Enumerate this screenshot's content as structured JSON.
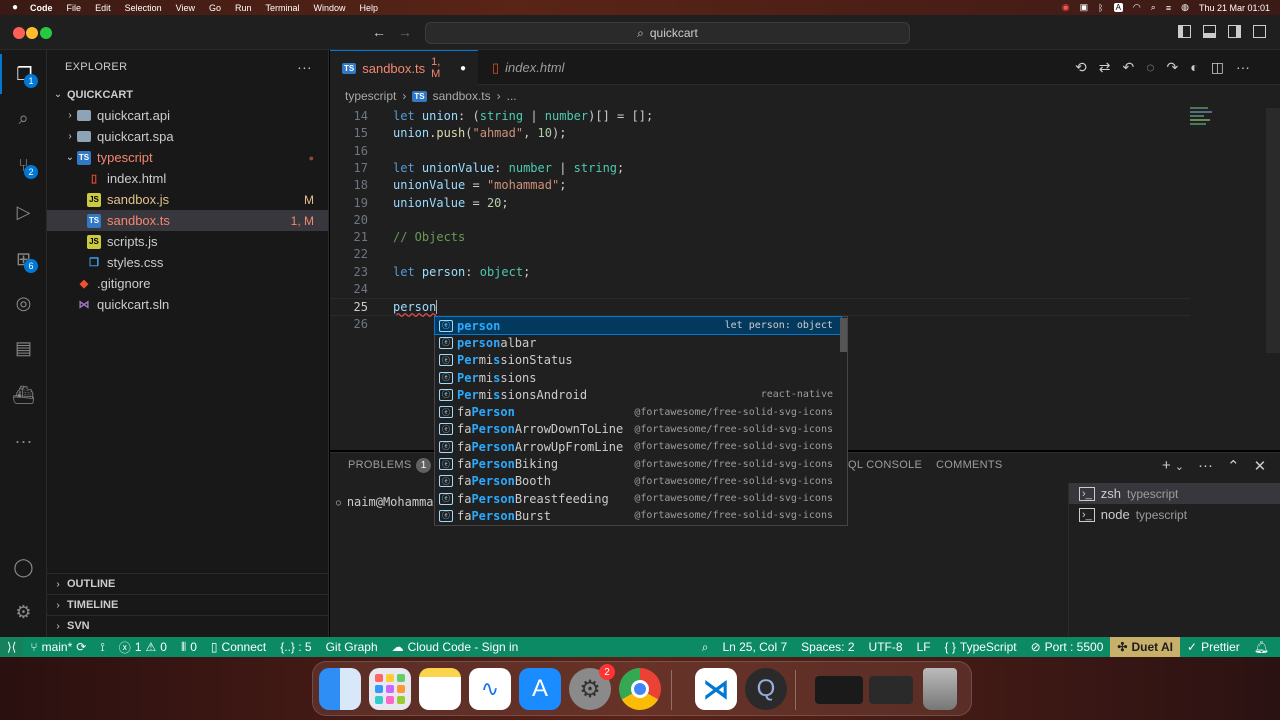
{
  "menubar": {
    "app": "Code",
    "items": [
      "File",
      "Edit",
      "Selection",
      "View",
      "Go",
      "Run",
      "Terminal",
      "Window",
      "Help"
    ],
    "datetime": "Thu 21 Mar  01:01"
  },
  "titlebar": {
    "search": "quickcart"
  },
  "activity": {
    "explorer_badge": "1",
    "scm_badge": "2",
    "extensions_badge": "6"
  },
  "sidebar": {
    "title": "EXPLORER",
    "more": "···",
    "root": "QUICKCART",
    "items": [
      {
        "label": "quickcart.api",
        "kind": "folder",
        "status": ""
      },
      {
        "label": "quickcart.spa",
        "kind": "folder",
        "status": ""
      },
      {
        "label": "typescript",
        "kind": "ts-folder",
        "status": ""
      },
      {
        "label": "index.html",
        "kind": "html",
        "status": ""
      },
      {
        "label": "sandbox.js",
        "kind": "js",
        "status": "M"
      },
      {
        "label": "sandbox.ts",
        "kind": "ts",
        "status": "1, M"
      },
      {
        "label": "scripts.js",
        "kind": "js",
        "status": ""
      },
      {
        "label": "styles.css",
        "kind": "css",
        "status": ""
      },
      {
        "label": ".gitignore",
        "kind": "git",
        "status": ""
      },
      {
        "label": "quickcart.sln",
        "kind": "sln",
        "status": ""
      }
    ],
    "outline": "OUTLINE",
    "timeline": "TIMELINE",
    "svn": "SVN"
  },
  "tabs": [
    {
      "label": "sandbox.ts",
      "badge": "1, M",
      "icon": "TS"
    },
    {
      "label": "index.html",
      "badge": "",
      "icon": "html"
    }
  ],
  "breadcrumbs": [
    "typescript",
    "sandbox.ts",
    "..."
  ],
  "code": {
    "line_numbers": [
      "14",
      "15",
      "16",
      "17",
      "18",
      "19",
      "20",
      "21",
      "22",
      "23",
      "24",
      "25",
      "26"
    ],
    "active_line": "25"
  },
  "suggest": {
    "items": [
      {
        "pre": "",
        "match": "person",
        "post": "",
        "detail": "let person: object"
      },
      {
        "pre": "",
        "match": "person",
        "post": "albar",
        "detail": ""
      },
      {
        "pre": "",
        "match": "Per",
        "post": "mi",
        "match2": "s",
        "post2": "sionStatus",
        "detail": ""
      },
      {
        "pre": "",
        "match": "Per",
        "post": "mi",
        "match2": "s",
        "post2": "sions",
        "detail": ""
      },
      {
        "pre": "",
        "match": "Per",
        "post": "mi",
        "match2": "s",
        "post2": "sionsAndroid",
        "detail": "react-native"
      },
      {
        "pre": "fa",
        "match": "Person",
        "post": "",
        "detail": "@fortawesome/free-solid-svg-icons"
      },
      {
        "pre": "fa",
        "match": "Person",
        "post": "ArrowDownToLine",
        "detail": "@fortawesome/free-solid-svg-icons"
      },
      {
        "pre": "fa",
        "match": "Person",
        "post": "ArrowUpFromLine",
        "detail": "@fortawesome/free-solid-svg-icons"
      },
      {
        "pre": "fa",
        "match": "Person",
        "post": "Biking",
        "detail": "@fortawesome/free-solid-svg-icons"
      },
      {
        "pre": "fa",
        "match": "Person",
        "post": "Booth",
        "detail": "@fortawesome/free-solid-svg-icons"
      },
      {
        "pre": "fa",
        "match": "Person",
        "post": "Breastfeeding",
        "detail": "@fortawesome/free-solid-svg-icons"
      },
      {
        "pre": "fa",
        "match": "Person",
        "post": "Burst",
        "detail": "@fortawesome/free-solid-svg-icons"
      }
    ]
  },
  "panel": {
    "problems": "PROBLEMS",
    "problems_count": "1",
    "sql_console": "QL CONSOLE",
    "comments": "COMMENTS",
    "prompt": "naim@Mohammad",
    "terminals": [
      {
        "name": "zsh",
        "cwd": "typescript"
      },
      {
        "name": "node",
        "cwd": "typescript"
      }
    ]
  },
  "statusbar": {
    "branch": "main*",
    "errors": "1",
    "warnings": "0",
    "ports_icon_count": "0",
    "connect": "Connect",
    "json": "{..} : 5",
    "git_graph": "Git Graph",
    "cloud_code": "Cloud Code - Sign in",
    "position": "Ln 25, Col 7",
    "spaces": "Spaces: 2",
    "encoding": "UTF-8",
    "eol": "LF",
    "language": "TypeScript",
    "port": "Port : 5500",
    "duet": "Duet AI",
    "prettier": "Prettier"
  },
  "dock": {
    "settings_badge": "2"
  }
}
